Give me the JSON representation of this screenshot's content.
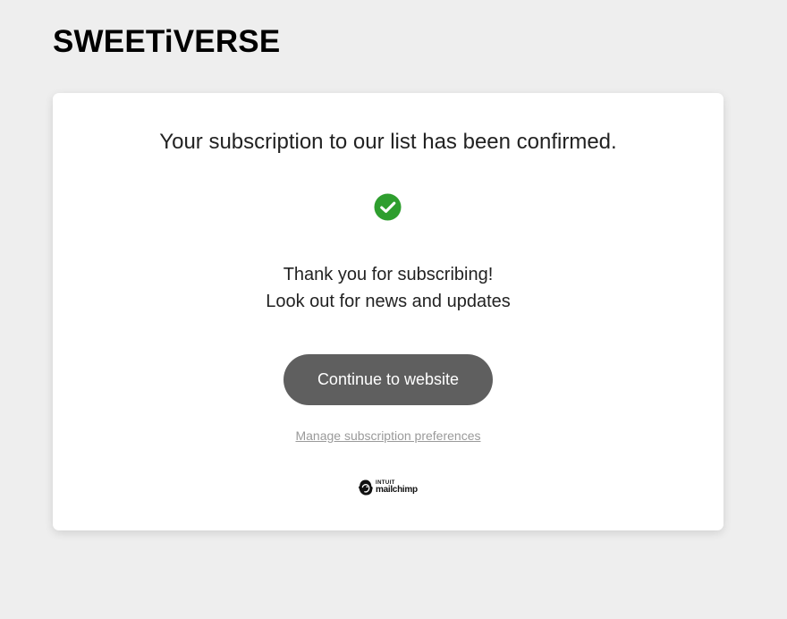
{
  "header": {
    "brand": "SWEETiVERSE"
  },
  "card": {
    "headline": "Your subscription to our list has been confirmed.",
    "status_icon": "check-circle-icon",
    "status_color": "#2e9e2e",
    "message_line_1": "Thank you for subscribing!",
    "message_line_2": "Look out for news and updates",
    "continue_label": "Continue to website",
    "manage_label": "Manage subscription preferences",
    "footer_logo": {
      "top": "INTUIT",
      "bottom": "mailchimp"
    }
  },
  "colors": {
    "background": "#eeeeee",
    "card": "#ffffff",
    "button": "#5f5f5f",
    "link": "#9a9a9a"
  }
}
